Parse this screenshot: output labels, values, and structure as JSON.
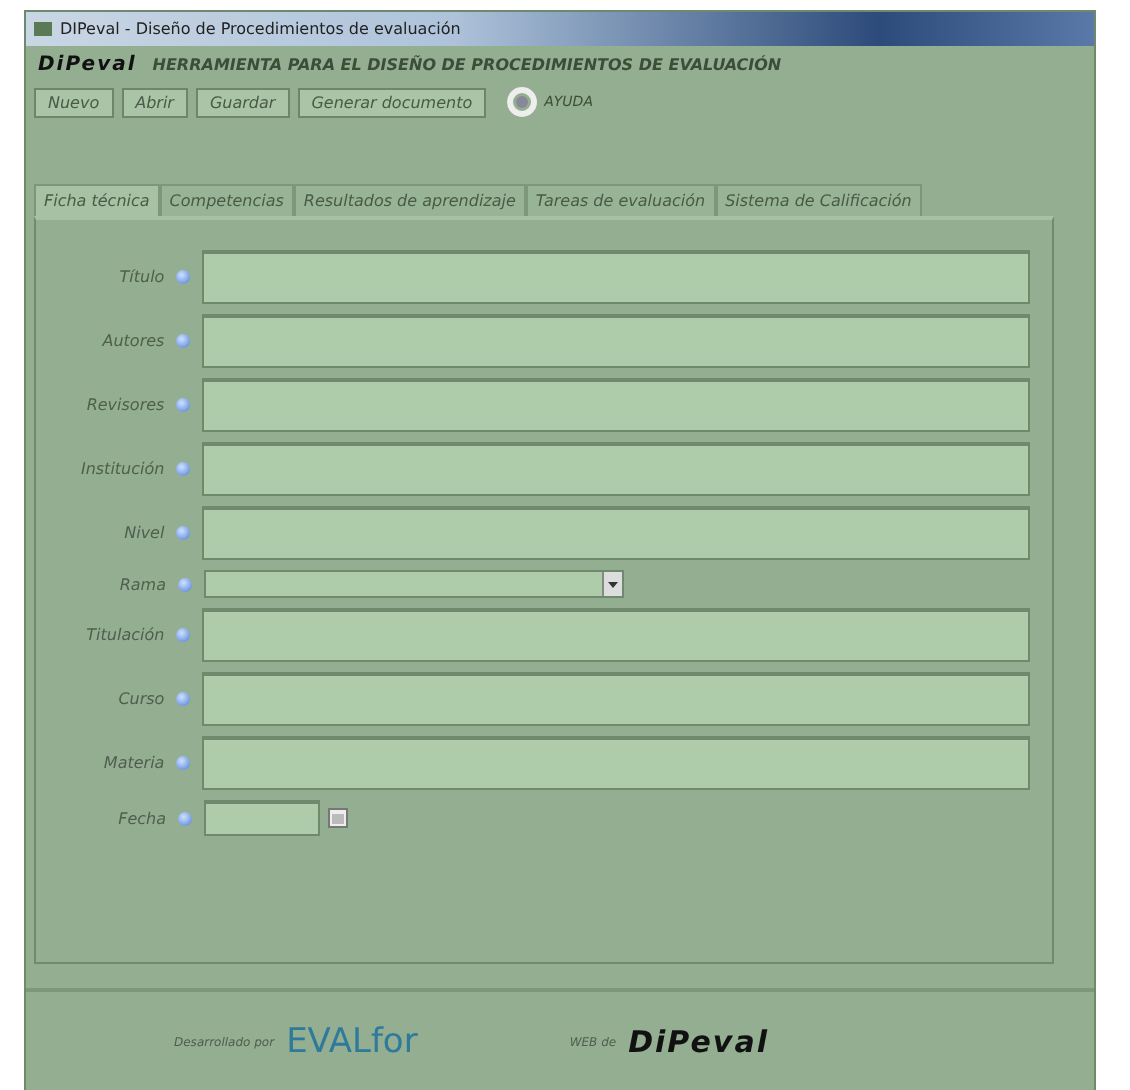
{
  "window": {
    "title": "DIPeval - Diseño de Procedimientos de evaluación"
  },
  "header": {
    "logo": "DiPeval",
    "title": "HERRAMIENTA PARA EL DISEÑO DE PROCEDIMIENTOS DE EVALUACIÓN"
  },
  "toolbar": {
    "buttons": [
      "Nuevo",
      "Abrir",
      "Guardar",
      "Generar documento"
    ],
    "help": "AYUDA"
  },
  "tabs": [
    {
      "label": "Ficha técnica",
      "selected": true
    },
    {
      "label": "Competencias",
      "selected": false
    },
    {
      "label": "Resultados de aprendizaje",
      "selected": false
    },
    {
      "label": "Tareas de evaluación",
      "selected": false
    },
    {
      "label": "Sistema de Calificación",
      "selected": false
    }
  ],
  "form": [
    {
      "label": "Título",
      "kind": "text"
    },
    {
      "label": "Autores",
      "kind": "text"
    },
    {
      "label": "Revisores",
      "kind": "text"
    },
    {
      "label": "Institución",
      "kind": "text"
    },
    {
      "label": "Nivel",
      "kind": "text"
    },
    {
      "label": "Rama",
      "kind": "select"
    },
    {
      "label": "Titulación",
      "kind": "text"
    },
    {
      "label": "Curso",
      "kind": "text"
    },
    {
      "label": "Materia",
      "kind": "text"
    },
    {
      "label": "Fecha",
      "kind": "date"
    }
  ],
  "footer": {
    "developed_by": "Desarrollado por",
    "developer_logo": "EVALfor",
    "web_label": "WEB de",
    "web_logo": "DiPeval"
  }
}
